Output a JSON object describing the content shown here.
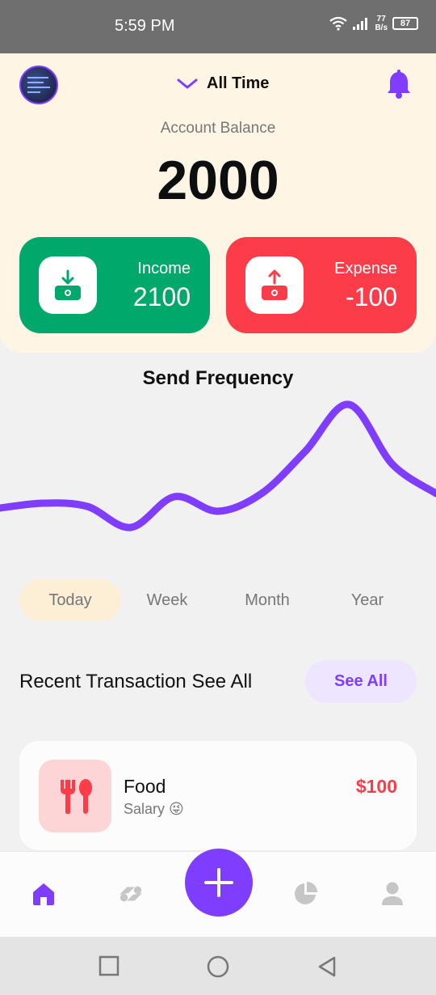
{
  "status": {
    "time": "5:59 PM",
    "speed_value": "77",
    "speed_unit": "B/s",
    "battery": "87"
  },
  "header": {
    "period_label": "All Time",
    "balance_label": "Account Balance",
    "balance_value": "2000",
    "income": {
      "label": "Income",
      "value": "2100",
      "color": "#00a86b"
    },
    "expense": {
      "label": "Expense",
      "value": "-100",
      "color": "#fd3c4a"
    }
  },
  "chart": {
    "title": "Send Frequency",
    "accent": "#7f3dff"
  },
  "chart_data": {
    "type": "line",
    "title": "Send Frequency",
    "x": [
      0,
      1,
      2,
      3,
      4,
      5,
      6,
      7,
      8,
      9,
      10
    ],
    "series": [
      {
        "values": [
          3.1,
          3.4,
          3.2,
          1.9,
          3.8,
          2.9,
          4.0,
          6.6,
          9.5,
          5.8,
          4.0
        ]
      }
    ],
    "ylim": [
      0,
      10
    ],
    "grid": false
  },
  "tabs": [
    {
      "label": "Today",
      "active": true
    },
    {
      "label": "Week",
      "active": false
    },
    {
      "label": "Month",
      "active": false
    },
    {
      "label": "Year",
      "active": false
    }
  ],
  "recent": {
    "title": "Recent Transaction See All",
    "see_all": "See All"
  },
  "transactions": [
    {
      "name": "Food",
      "subtitle": "Salary 😜",
      "amount": "$100",
      "icon": "fork-spoon-icon"
    }
  ],
  "nav": {
    "items": [
      "home-icon",
      "transaction-icon",
      "add-icon",
      "budget-pie-icon",
      "profile-icon"
    ],
    "active": "home-icon"
  },
  "colors": {
    "primary": "#7f3dff",
    "header_bg": "#fff5e4"
  }
}
